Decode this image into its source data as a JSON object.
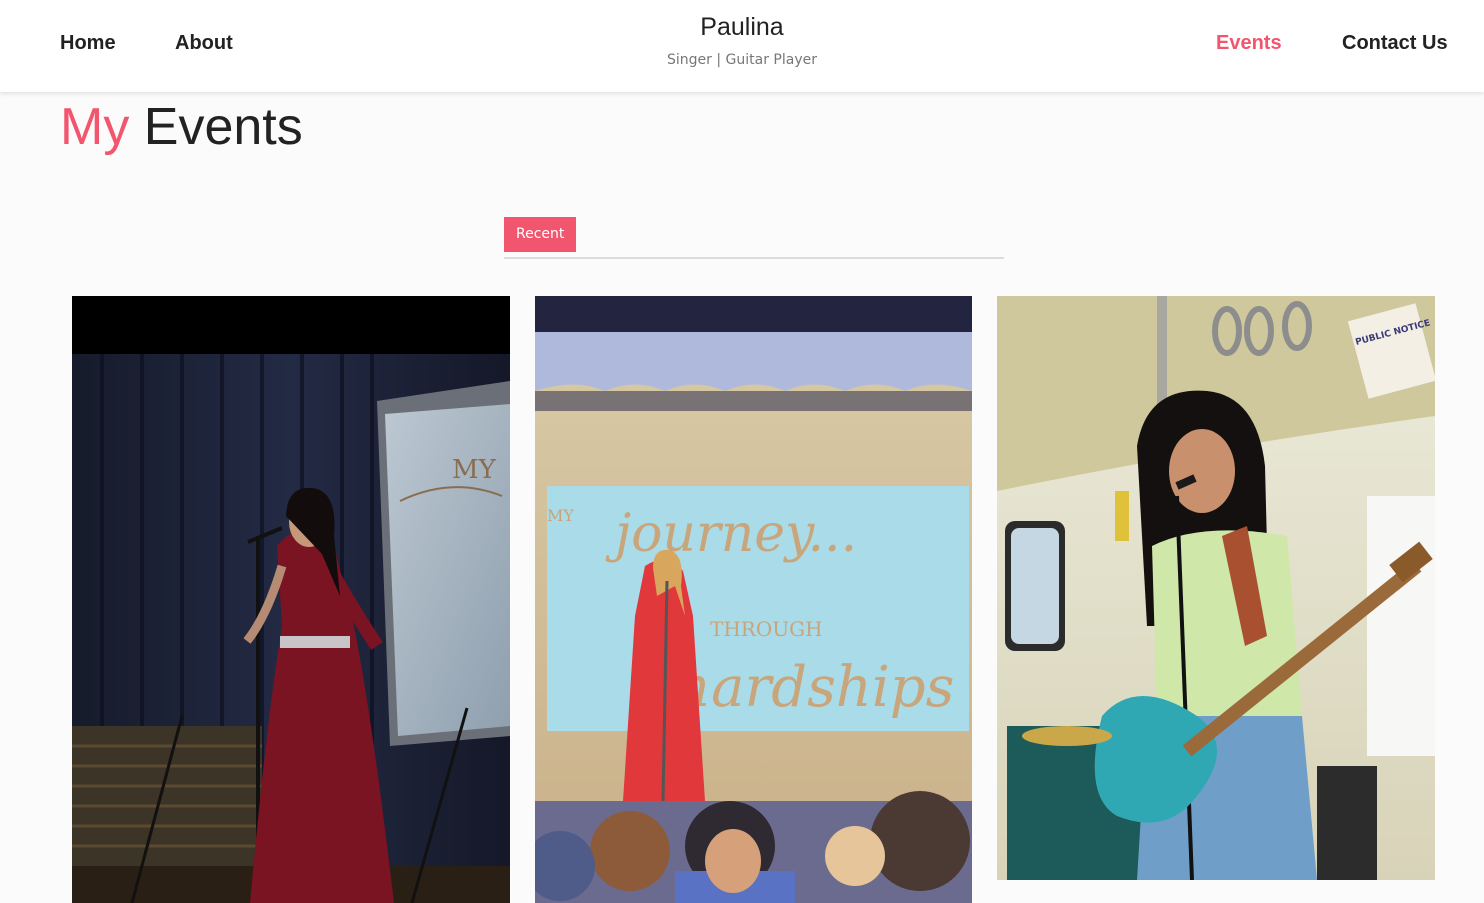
{
  "nav": {
    "home": "Home",
    "about": "About",
    "events": "Events",
    "contact": "Contact Us"
  },
  "brand": {
    "name": "Paulina",
    "tagline": "Singer | Guitar Player"
  },
  "page": {
    "title_accent": "My",
    "title_rest": "Events"
  },
  "tabs": {
    "recent": "Recent"
  },
  "events": [
    {
      "photo_text": "MY"
    },
    {
      "photo_text_1": "MY",
      "photo_text_2": "journey...",
      "photo_text_3": "THROUGH",
      "photo_text_4": "hardships"
    },
    {
      "photo_text": "PUBLIC NOTICE"
    }
  ],
  "colors": {
    "accent": "#f2566e",
    "text": "#222222",
    "muted": "#777777"
  }
}
